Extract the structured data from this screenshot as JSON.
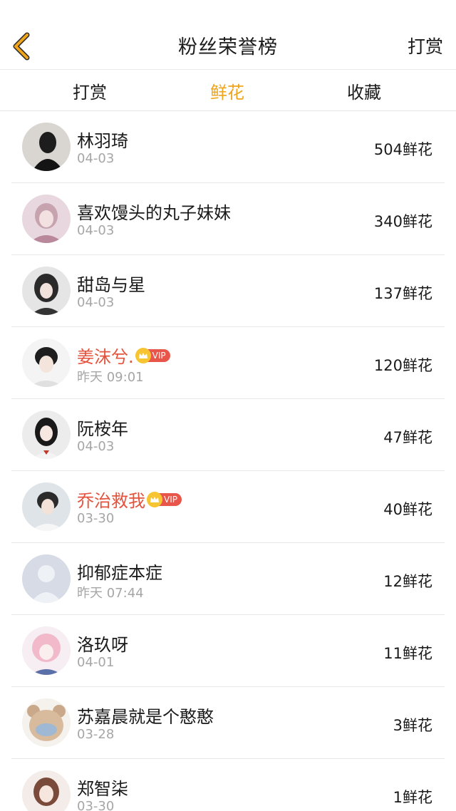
{
  "header": {
    "title": "粉丝荣誉榜",
    "action_label": "打赏",
    "back_icon": "chevron-left-icon",
    "back_color": "#f0a41a"
  },
  "tabs": [
    {
      "label": "打赏",
      "active": false
    },
    {
      "label": "鲜花",
      "active": true
    },
    {
      "label": "收藏",
      "active": false
    }
  ],
  "colors": {
    "accent": "#f0a41a",
    "vip_name": "#e5533d",
    "vip_badge": "#e8554a"
  },
  "fans": [
    {
      "name": "林羽琦",
      "date": "04-03",
      "flowers": "504鲜花",
      "vip": false
    },
    {
      "name": "喜欢馒头的丸子妹妹",
      "date": "04-03",
      "flowers": "340鲜花",
      "vip": false
    },
    {
      "name": "甜岛与星",
      "date": "04-03",
      "flowers": "137鲜花",
      "vip": false
    },
    {
      "name": "姜沫兮.",
      "date": "昨天 09:01",
      "flowers": "120鲜花",
      "vip": true,
      "vip_label": "VIP"
    },
    {
      "name": "阮桉年",
      "date": "04-03",
      "flowers": "47鲜花",
      "vip": false
    },
    {
      "name": "乔治救我",
      "date": "03-30",
      "flowers": "40鲜花",
      "vip": true,
      "vip_label": "VIP"
    },
    {
      "name": "抑郁症本症",
      "date": "昨天 07:44",
      "flowers": "12鲜花",
      "vip": false
    },
    {
      "name": "洛玖呀",
      "date": "04-01",
      "flowers": "11鲜花",
      "vip": false
    },
    {
      "name": "苏嘉晨就是个憨憨",
      "date": "03-28",
      "flowers": "3鲜花",
      "vip": false
    },
    {
      "name": "郑智柒",
      "date": "03-30",
      "flowers": "1鲜花",
      "vip": false
    }
  ]
}
